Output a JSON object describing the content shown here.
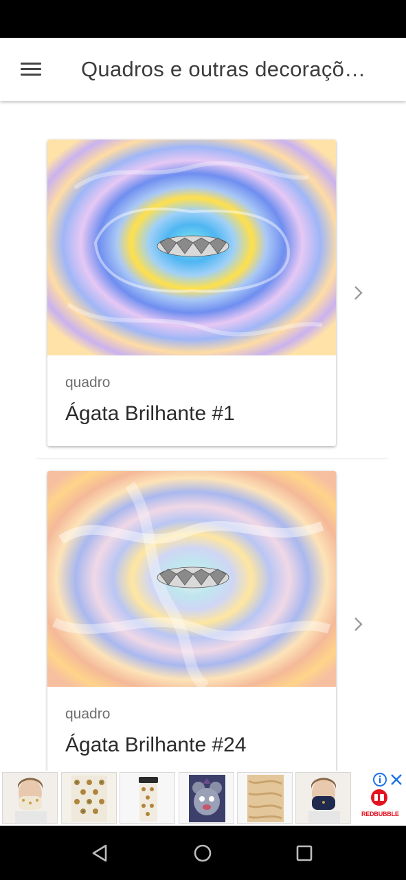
{
  "app_bar": {
    "title": "Quadros e outras decoraçõ…",
    "menu_icon": "hamburger-menu-icon"
  },
  "cards": [
    {
      "type": "quadro",
      "title": "Ágata Brilhante #1"
    },
    {
      "type": "quadro",
      "title": "Ágata Brilhante #24"
    }
  ],
  "ad": {
    "brand": "REDBUBBLE",
    "brand_color": "#e41321",
    "info_color": "#1a73e8",
    "products": [
      "face-mask",
      "pattern-print",
      "travel-mug",
      "character-print",
      "texture-print",
      "face-mask-navy"
    ]
  },
  "system_nav": {
    "back_icon": "back-triangle-icon",
    "home_icon": "home-circle-icon",
    "recent_icon": "recent-apps-square-icon"
  }
}
